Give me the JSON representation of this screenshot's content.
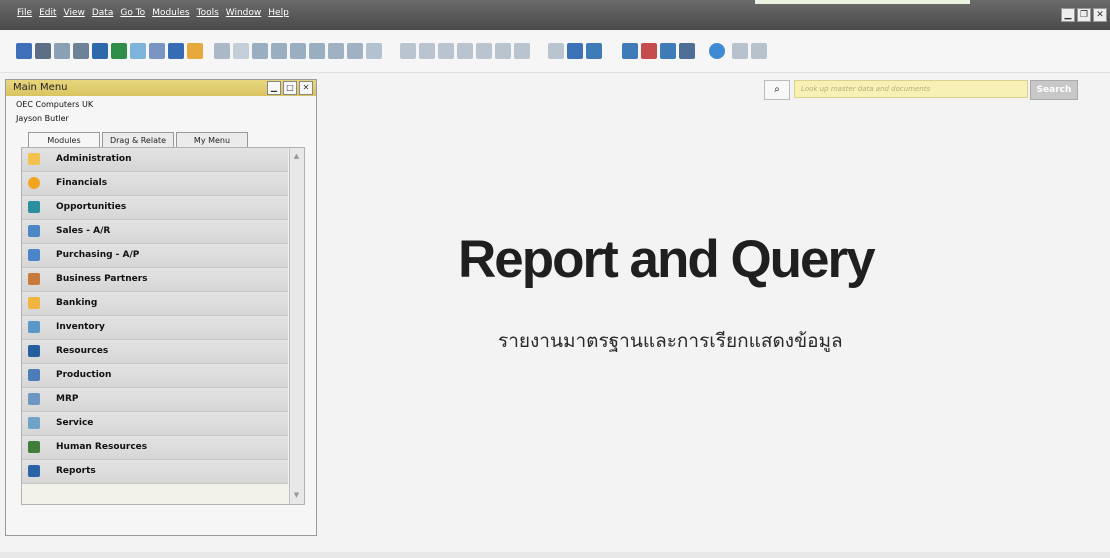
{
  "menubar": {
    "items": [
      "File",
      "Edit",
      "View",
      "Data",
      "Go To",
      "Modules",
      "Tools",
      "Window",
      "Help"
    ]
  },
  "search": {
    "placeholder": "Look up master data and documents",
    "button_label": "Search"
  },
  "main_menu": {
    "title": "Main Menu",
    "company": "OEC Computers UK",
    "user": "Jayson Butler",
    "tabs": [
      "Modules",
      "Drag & Relate",
      "My Menu"
    ],
    "modules": [
      {
        "label": "Administration",
        "icon": "administration-icon",
        "color": "#f3c24c"
      },
      {
        "label": "Financials",
        "icon": "financials-icon",
        "color": "#f4a520"
      },
      {
        "label": "Opportunities",
        "icon": "opportunities-icon",
        "color": "#2c8f9f"
      },
      {
        "label": "Sales - A/R",
        "icon": "sales-icon",
        "color": "#4b87c3"
      },
      {
        "label": "Purchasing - A/P",
        "icon": "purchasing-icon",
        "color": "#4a85c9"
      },
      {
        "label": "Business Partners",
        "icon": "business-partners-icon",
        "color": "#c87a3c"
      },
      {
        "label": "Banking",
        "icon": "banking-icon",
        "color": "#f0b540"
      },
      {
        "label": "Inventory",
        "icon": "inventory-icon",
        "color": "#5a98c7"
      },
      {
        "label": "Resources",
        "icon": "resources-icon",
        "color": "#255e9e"
      },
      {
        "label": "Production",
        "icon": "production-icon",
        "color": "#4b7db8"
      },
      {
        "label": "MRP",
        "icon": "mrp-icon",
        "color": "#6d97c2"
      },
      {
        "label": "Service",
        "icon": "service-icon",
        "color": "#6fa4c8"
      },
      {
        "label": "Human Resources",
        "icon": "human-resources-icon",
        "color": "#3f7d3a"
      },
      {
        "label": "Reports",
        "icon": "reports-icon",
        "color": "#2a64a7"
      }
    ]
  },
  "content": {
    "heading": "Report and Query",
    "subheading": "รายงานมาตรฐานและการเรียกแสดงข้อมูล"
  }
}
